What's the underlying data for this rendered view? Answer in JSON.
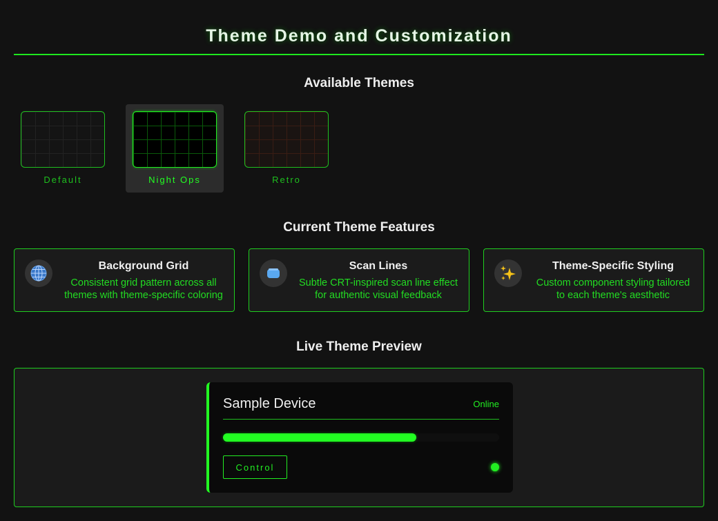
{
  "page": {
    "title": "Theme Demo and Customization"
  },
  "themes": {
    "section_title": "Available Themes",
    "items": [
      {
        "label": "Default",
        "selected": false
      },
      {
        "label": "Night Ops",
        "selected": true
      },
      {
        "label": "Retro",
        "selected": false
      }
    ]
  },
  "features": {
    "section_title": "Current Theme Features",
    "items": [
      {
        "icon": "globe-icon",
        "title": "Background Grid",
        "description": "Consistent grid pattern across all themes with theme-specific coloring"
      },
      {
        "icon": "scan-lines-icon",
        "title": "Scan Lines",
        "description": "Subtle CRT-inspired scan line effect for authentic visual feedback"
      },
      {
        "icon": "sparkles-icon",
        "title": "Theme-Specific Styling",
        "description": "Custom component styling tailored to each theme's aesthetic"
      }
    ]
  },
  "preview": {
    "section_title": "Live Theme Preview",
    "device": {
      "name": "Sample Device",
      "status": "Online",
      "progress_fraction": 0.7,
      "control_label": "Control"
    }
  },
  "colors": {
    "accent": "#22ff22",
    "background": "#121212",
    "card_background": "#1b1b1b"
  }
}
